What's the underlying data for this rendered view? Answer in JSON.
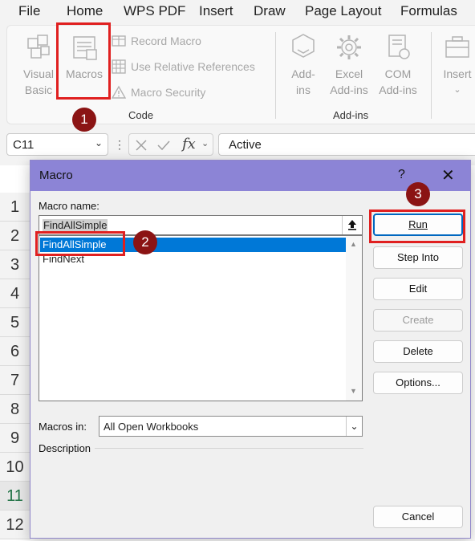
{
  "menubar": {
    "items": [
      "File",
      "Home",
      "WPS PDF",
      "Insert",
      "Draw",
      "Page Layout",
      "Formulas"
    ]
  },
  "ribbon": {
    "visual_basic": [
      "Visual",
      "Basic"
    ],
    "macros": "Macros",
    "record_macro": "Record Macro",
    "use_relative_references": "Use Relative References",
    "macro_security": "Macro Security",
    "code_group": "Code",
    "addins": [
      "Add-",
      "ins"
    ],
    "excel_addins": [
      "Excel",
      "Add-ins"
    ],
    "com_addins": [
      "COM",
      "Add-ins"
    ],
    "addins_group": "Add-ins",
    "insert": "Insert"
  },
  "formula_bar": {
    "name_box": "C11",
    "formula_value": "Active"
  },
  "rows": [
    "1",
    "2",
    "3",
    "4",
    "5",
    "6",
    "7",
    "8",
    "9",
    "10",
    "11",
    "12"
  ],
  "active_row": "11",
  "dialog": {
    "title": "Macro",
    "help": "?",
    "close": "✕",
    "macro_name_label": "Macro name:",
    "macro_name_value": "FindAllSimple",
    "macro_list": [
      "FindAllSimple",
      "FindNext"
    ],
    "selected_macro": "FindAllSimple",
    "buttons": {
      "run": "Run",
      "step_into": "Step Into",
      "edit": "Edit",
      "create": "Create",
      "delete": "Delete",
      "options": "Options...",
      "cancel": "Cancel"
    },
    "macros_in_label": "Macros in:",
    "macros_in_value": "All Open Workbooks",
    "description_label": "Description"
  },
  "annotations": [
    "1",
    "2",
    "3"
  ],
  "colors": {
    "annotation_red": "#e02020",
    "badge": "#8b1414",
    "titlebar": "#8c84d6",
    "selection": "#0078d7"
  }
}
